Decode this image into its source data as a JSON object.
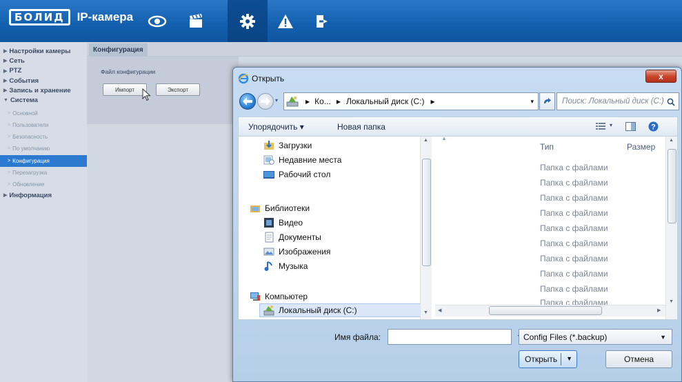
{
  "header": {
    "logo_box": "БОЛИД",
    "logo_text": "IP-камера",
    "nav_icons": [
      "eye-icon",
      "clapperboard-icon",
      "gear-icon",
      "warning-icon",
      "logout-icon"
    ],
    "active_nav": "gear-icon"
  },
  "sidebar": {
    "top_items": [
      "Настройки камеры",
      "Сеть",
      "PTZ",
      "События",
      "Запись и хранение",
      "Система"
    ],
    "system_subitems": [
      "Основной",
      "Пользователи",
      "Безопасность",
      "По умолчанию",
      "Конфигурация",
      "Перезагрузка",
      "Обновление"
    ],
    "selected": "Конфигурация",
    "bottom_item": "Информация"
  },
  "content": {
    "tab": "Конфигурация",
    "label": "Файл конфигурации",
    "import_button": "Импорт",
    "export_button": "Экспорт"
  },
  "dialog": {
    "title": "Открыть",
    "close_label": "x",
    "address": {
      "seg1": "Ко...",
      "seg2": "Локальный диск (C:)"
    },
    "search_placeholder": "Поиск: Локальный диск (C:)",
    "toolbar": {
      "organize": "Упорядочить ▾",
      "new_folder": "Новая папка"
    },
    "nav": {
      "downloads": "Загрузки",
      "recent": "Недавние места",
      "desktop": "Рабочий стол",
      "libraries": "Библиотеки",
      "video": "Видео",
      "documents": "Документы",
      "pictures": "Изображения",
      "music": "Музыка",
      "computer": "Компьютер",
      "local_disk": "Локальный диск (C:)"
    },
    "columns": {
      "type": "Тип",
      "size": "Размер"
    },
    "file_types": [
      "Папка с файлами",
      "Папка с файлами",
      "Папка с файлами",
      "Папка с файлами",
      "Папка с файлами",
      "Папка с файлами",
      "Папка с файлами",
      "Папка с файлами",
      "Папка с файлами",
      "Папка с файлами"
    ],
    "filename_label": "Имя файла:",
    "filename_value": "",
    "filetype_value": "Config Files (*.backup)",
    "open_button": "Открыть",
    "cancel_button": "Отмена"
  },
  "colors": {
    "header_blue": "#1461b0",
    "selection_blue": "#2c7ad0",
    "close_red": "#c9462c"
  }
}
